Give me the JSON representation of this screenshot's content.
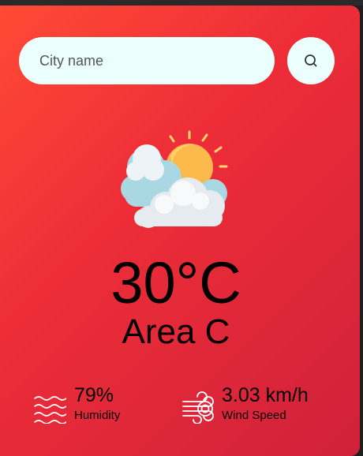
{
  "search": {
    "placeholder": "City name",
    "value": ""
  },
  "weather": {
    "icon": "sun-behind-clouds-icon",
    "temperature": "30°C",
    "city": "Area C"
  },
  "stats": {
    "humidity": {
      "icon": "humidity-waves-icon",
      "value": "79%",
      "label": "Humidity"
    },
    "wind": {
      "icon": "wind-icon",
      "value": "3.03 km/h",
      "label": "Wind Speed"
    }
  },
  "colors": {
    "card_gradient_start": "#ff4a35",
    "card_gradient_end": "#d0213a",
    "input_background": "#ebfffd",
    "text": "#000000"
  }
}
